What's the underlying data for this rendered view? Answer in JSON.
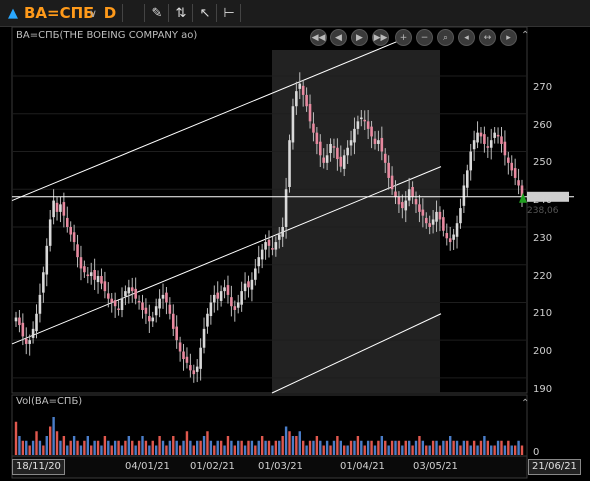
{
  "toolbar": {
    "symbol": "BA=СПБ",
    "timeframe": "D",
    "icons": [
      "triangle-up-icon",
      "chevron-down-icon",
      "pencil-icon",
      "chart-type-icon",
      "cursor-icon",
      "indicators-icon"
    ]
  },
  "price_panel": {
    "title": "BA=СПБ(THE BOEING COMPANY ao)",
    "last_price": 238,
    "last_price_label": "238,06",
    "colors": {
      "up": "#d9d9d9",
      "down": "#e88aa0",
      "channel": "#ffffff",
      "last": "#20a020"
    }
  },
  "volume_panel": {
    "title": "Vol(BA=СПБ)",
    "zero_label": "0"
  },
  "nav_buttons": [
    "rewind-icon",
    "step-back-icon",
    "play-icon",
    "fast-forward-icon",
    "zoom-in-icon",
    "zoom-out-icon",
    "zoom-fit-icon",
    "scroll-left-icon",
    "scroll-both-icon",
    "scroll-right-icon",
    "end-icon"
  ],
  "chart_data": {
    "type": "candlestick",
    "title": "BA=СПБ(THE BOEING COMPANY ao)",
    "y_ticks": [
      190,
      200,
      210,
      220,
      230,
      240,
      250,
      260,
      270
    ],
    "ylim": [
      186,
      283
    ],
    "x_ticks": [
      "18/11/20",
      "04/01/21",
      "01/02/21",
      "01/03/21",
      "01/04/21",
      "03/05/21",
      "21/06/21"
    ],
    "x_range": [
      "18/11/20",
      "21/06/21"
    ],
    "closes": [
      206,
      204,
      201,
      199,
      200,
      203,
      207,
      212,
      218,
      225,
      232,
      237,
      234,
      236,
      233,
      230,
      228,
      226,
      222,
      219,
      218,
      217,
      218,
      216,
      217,
      215,
      213,
      211,
      210,
      209,
      208,
      211,
      213,
      214,
      213,
      211,
      210,
      208,
      207,
      205,
      206,
      209,
      211,
      212,
      210,
      207,
      203,
      200,
      197,
      195,
      194,
      192,
      191,
      193,
      198,
      203,
      207,
      210,
      212,
      211,
      213,
      214,
      212,
      209,
      208,
      210,
      213,
      215,
      214,
      216,
      219,
      222,
      224,
      226,
      225,
      224,
      226,
      228,
      230,
      240,
      253,
      262,
      266,
      268,
      265,
      262,
      258,
      255,
      252,
      249,
      247,
      249,
      252,
      251,
      248,
      246,
      249,
      251,
      253,
      256,
      258,
      259,
      258,
      256,
      254,
      252,
      253,
      250,
      247,
      243,
      240,
      238,
      236,
      235,
      237,
      240,
      238,
      236,
      234,
      233,
      231,
      230,
      232,
      234,
      232,
      229,
      227,
      226,
      228,
      231,
      235,
      241,
      245,
      250,
      253,
      255,
      254,
      252,
      251,
      253,
      255,
      254,
      252,
      249,
      247,
      245,
      243,
      241,
      238
    ],
    "volumes": [
      7,
      4,
      3,
      3,
      2,
      3,
      5,
      3,
      2,
      4,
      6,
      8,
      5,
      3,
      4,
      2,
      3,
      4,
      3,
      2,
      3,
      4,
      2,
      3,
      3,
      2,
      4,
      3,
      2,
      3,
      3,
      2,
      3,
      4,
      3,
      2,
      3,
      4,
      3,
      2,
      3,
      2,
      4,
      3,
      2,
      3,
      4,
      3,
      2,
      3,
      5,
      3,
      2,
      3,
      3,
      4,
      5,
      3,
      2,
      3,
      3,
      2,
      4,
      3,
      2,
      3,
      3,
      2,
      3,
      3,
      2,
      3,
      4,
      3,
      3,
      2,
      3,
      3,
      4,
      6,
      5,
      4,
      4,
      5,
      3,
      2,
      3,
      3,
      4,
      3,
      2,
      3,
      2,
      3,
      4,
      3,
      2,
      2,
      3,
      3,
      4,
      3,
      2,
      3,
      3,
      2,
      3,
      4,
      3,
      2,
      3,
      3,
      3,
      2,
      3,
      3,
      2,
      3,
      4,
      3,
      2,
      2,
      3,
      3,
      2,
      3,
      3,
      4,
      3,
      3,
      2,
      3,
      3,
      2,
      3,
      2,
      3,
      4,
      3,
      2,
      2,
      3,
      3,
      2,
      3,
      2,
      2,
      3,
      2
    ]
  }
}
